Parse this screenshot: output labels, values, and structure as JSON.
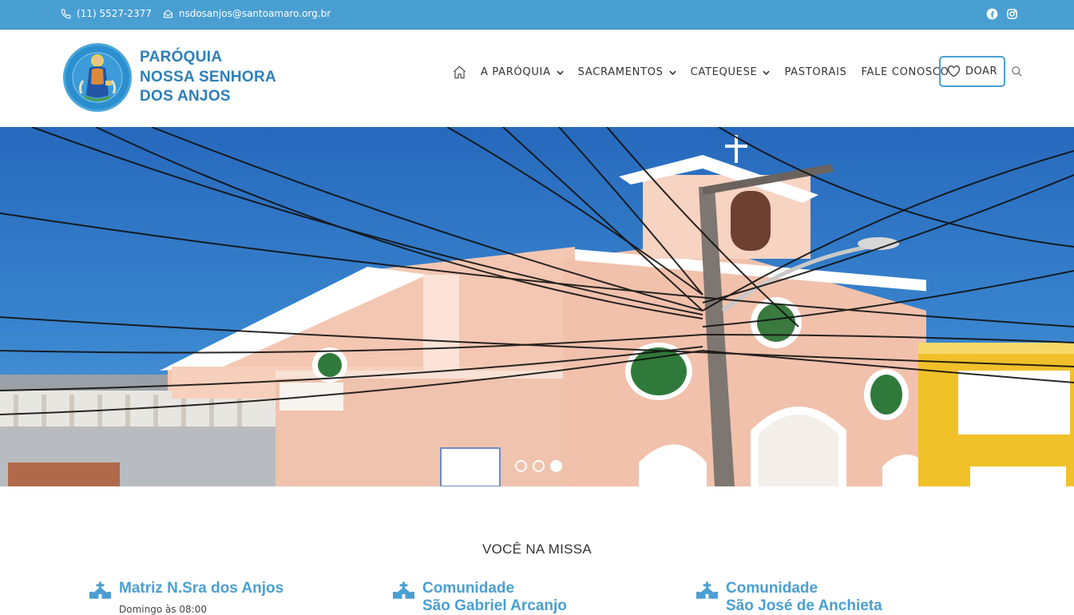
{
  "topbar": {
    "phone": "(11) 5527-2377",
    "email": "nsdosanjos@santoamaro.org.br",
    "social": [
      "facebook-icon",
      "instagram-icon"
    ]
  },
  "logo": {
    "line1": "PARÓQUIA",
    "line2": "NOSSA SENHORA",
    "line3": "DOS ANJOS"
  },
  "nav": {
    "items": [
      {
        "label": "A PARÓQUIA",
        "has_dropdown": true
      },
      {
        "label": "SACRAMENTOS",
        "has_dropdown": true
      },
      {
        "label": "CATEQUESE",
        "has_dropdown": true
      },
      {
        "label": "PASTORAIS",
        "has_dropdown": false
      },
      {
        "label": "FALE CONOSCO",
        "has_dropdown": false
      }
    ],
    "donate_label": "DOAR"
  },
  "slider": {
    "slide_count": 3,
    "active_slide": 3
  },
  "section": {
    "title": "VOCÊ NA MISSA",
    "cards": [
      {
        "title": "Matriz N.Sra dos Anjos",
        "subtitle": "",
        "detail": "Domingo às 08:00"
      },
      {
        "title": "Comunidade",
        "subtitle": "São Gabriel Arcanjo",
        "detail": ""
      },
      {
        "title": "Comunidade",
        "subtitle": "São José de Anchieta",
        "detail": ""
      }
    ]
  },
  "colors": {
    "accent": "#4a9fd2",
    "logo_text": "#2d7fb8",
    "nav_text": "#333333"
  }
}
